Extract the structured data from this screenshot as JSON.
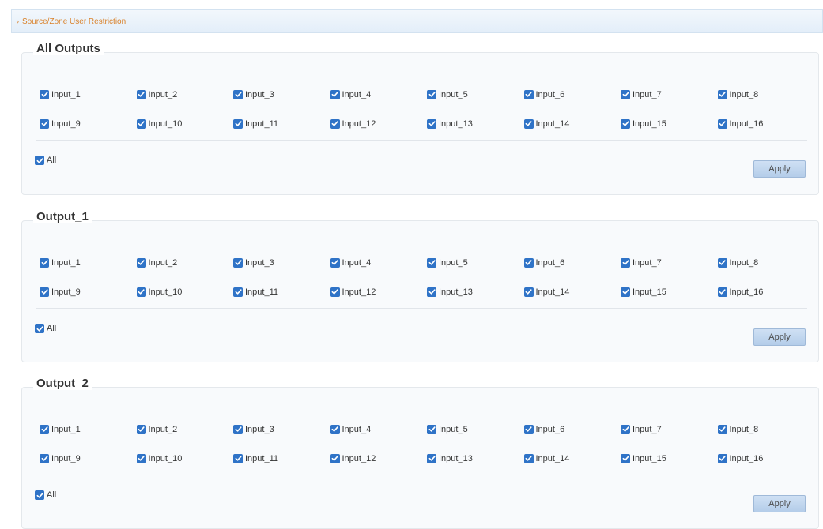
{
  "panel": {
    "title": "Source/Zone User Restriction"
  },
  "checkmark_color": "#2f73c7",
  "groups": [
    {
      "title": "All Outputs",
      "inputs": [
        "Input_1",
        "Input_2",
        "Input_3",
        "Input_4",
        "Input_5",
        "Input_6",
        "Input_7",
        "Input_8",
        "Input_9",
        "Input_10",
        "Input_11",
        "Input_12",
        "Input_13",
        "Input_14",
        "Input_15",
        "Input_16"
      ],
      "all_label": "All",
      "apply_label": "Apply"
    },
    {
      "title": "Output_1",
      "inputs": [
        "Input_1",
        "Input_2",
        "Input_3",
        "Input_4",
        "Input_5",
        "Input_6",
        "Input_7",
        "Input_8",
        "Input_9",
        "Input_10",
        "Input_11",
        "Input_12",
        "Input_13",
        "Input_14",
        "Input_15",
        "Input_16"
      ],
      "all_label": "All",
      "apply_label": "Apply"
    },
    {
      "title": "Output_2",
      "inputs": [
        "Input_1",
        "Input_2",
        "Input_3",
        "Input_4",
        "Input_5",
        "Input_6",
        "Input_7",
        "Input_8",
        "Input_9",
        "Input_10",
        "Input_11",
        "Input_12",
        "Input_13",
        "Input_14",
        "Input_15",
        "Input_16"
      ],
      "all_label": "All",
      "apply_label": "Apply"
    }
  ]
}
